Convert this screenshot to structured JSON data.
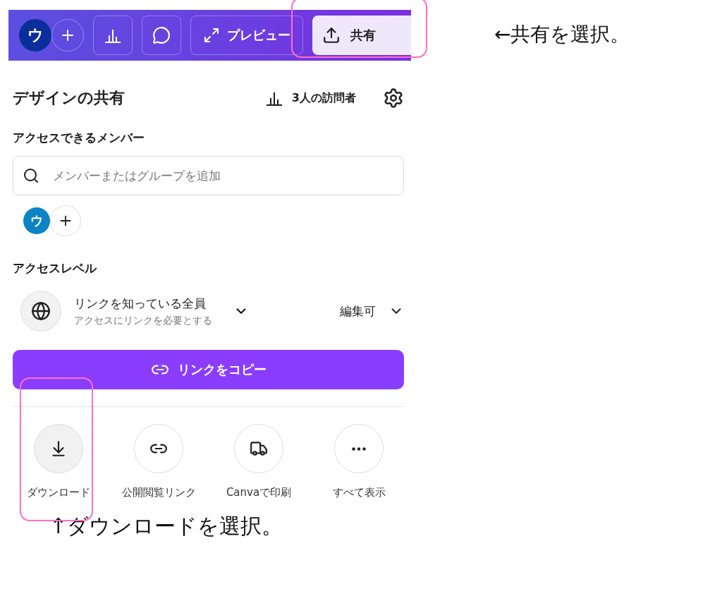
{
  "toolbar": {
    "avatar": "ウ",
    "preview": "プレビュー",
    "share": {
      "label": "共有",
      "highlighted": true
    }
  },
  "panel": {
    "title": "デザインの共有",
    "visitors": "3人の訪問者",
    "members_heading": "アクセスできるメンバー",
    "search": {
      "placeholder": "メンバーまたはグループを追加"
    },
    "members": [
      {
        "initial": "ウ"
      }
    ],
    "access_heading": "アクセスレベル",
    "access": {
      "title": "リンクを知っている全員",
      "subtitle": "アクセスにリンクを必要とする",
      "permission": "編集可"
    },
    "copy_button": "リンクをコピー",
    "actions": [
      {
        "kind": "download",
        "label": "ダウンロード",
        "highlighted": true
      },
      {
        "kind": "link",
        "label": "公開閲覧リンク",
        "highlighted": false
      },
      {
        "kind": "print",
        "label": "Canvaで印刷",
        "highlighted": false
      },
      {
        "kind": "more",
        "label": "すべて表示",
        "highlighted": false
      }
    ]
  },
  "annotations": [
    {
      "text": "←共有を選択。"
    },
    {
      "text": "↑ダウンロードを選択。"
    }
  ]
}
